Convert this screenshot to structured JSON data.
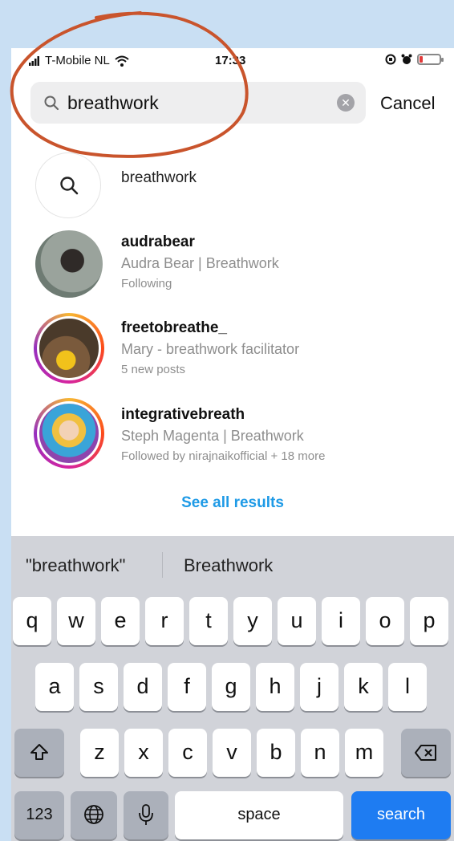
{
  "status_bar": {
    "carrier": "T-Mobile NL",
    "time": "17:33"
  },
  "search": {
    "query": "breathwork",
    "cancel_label": "Cancel"
  },
  "results": {
    "query_suggestion": "breathwork",
    "accounts": [
      {
        "username": "audrabear",
        "full_name": "Audra Bear | Breathwork",
        "meta": "Following"
      },
      {
        "username": "freetobreathe_",
        "full_name": "Mary - breathwork facilitator",
        "meta": "5 new posts"
      },
      {
        "username": "integrativebreath",
        "full_name": "Steph Magenta | Breathwork",
        "meta": "Followed by nirajnaikofficial + 18 more"
      }
    ],
    "see_all_label": "See all results"
  },
  "keyboard": {
    "suggestions": [
      "\"breathwork\"",
      "Breathwork"
    ],
    "row1": [
      "q",
      "w",
      "e",
      "r",
      "t",
      "y",
      "u",
      "i",
      "o",
      "p"
    ],
    "row2": [
      "a",
      "s",
      "d",
      "f",
      "g",
      "h",
      "j",
      "k",
      "l"
    ],
    "row3": [
      "z",
      "x",
      "c",
      "v",
      "b",
      "n",
      "m"
    ],
    "numbers_label": "123",
    "space_label": "space",
    "search_label": "search"
  },
  "annotation_color": "#c9542c"
}
